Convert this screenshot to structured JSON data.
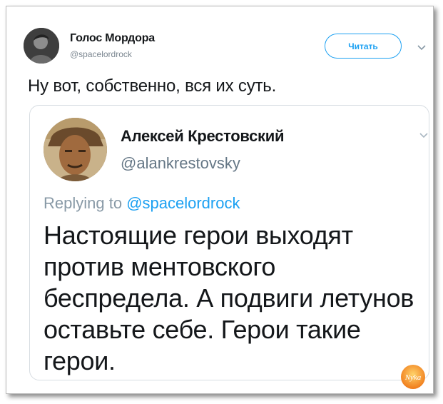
{
  "tweet": {
    "author_name": "Голос Мордора",
    "author_handle": "@spacelordrock",
    "follow_label": "Читать",
    "text": "Ну вот, собственно, вся их суть."
  },
  "quoted": {
    "author_name": "Алексей Крестовский",
    "author_handle": "@alankrestovsky",
    "reply_prefix": "Replying to ",
    "reply_handle": "@spacelordrock",
    "lines": [
      "Настоящие герои выходят",
      "против ментовского",
      "беспредела. А подвиги летунов",
      "оставьте себе. Герои такие",
      "герои."
    ]
  },
  "watermark": {
    "text": "Nyka"
  },
  "colors": {
    "accent": "#1da1f2",
    "text": "#14171a",
    "muted": "#8899a6",
    "border": "#d7dde2"
  },
  "icons": {
    "caret": "chevron-down-icon"
  }
}
